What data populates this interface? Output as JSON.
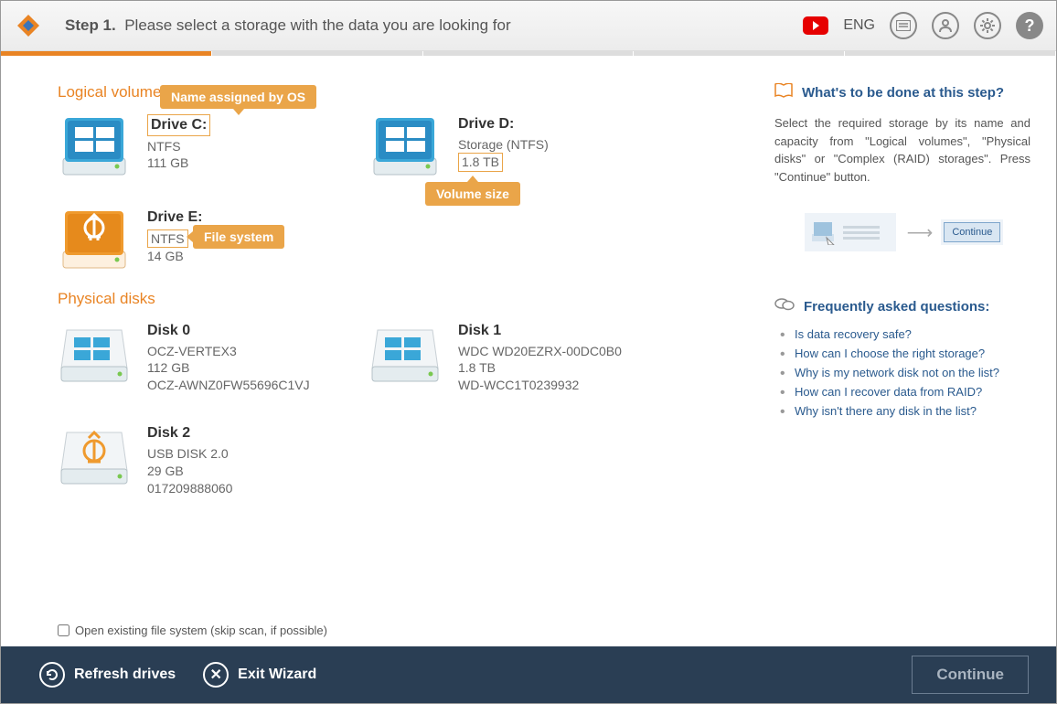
{
  "header": {
    "step_label": "Step 1.",
    "instruction": "Please select a storage with the data you are looking for",
    "lang": "ENG"
  },
  "sections": {
    "logical": "Logical volumes",
    "physical": "Physical disks"
  },
  "volumes": [
    {
      "name": "Drive C:",
      "fs": "NTFS",
      "size": "111 GB",
      "color": "blue"
    },
    {
      "name": "Drive D:",
      "fs": "Storage (NTFS)",
      "size": "1.8 TB",
      "color": "blue"
    },
    {
      "name": "Drive E:",
      "fs": "NTFS",
      "size": "14 GB",
      "color": "orange"
    }
  ],
  "disks": [
    {
      "name": "Disk 0",
      "model": "OCZ-VERTEX3",
      "size": "112 GB",
      "serial": "OCZ-AWNZ0FW55696C1VJ",
      "color": "blue"
    },
    {
      "name": "Disk 1",
      "model": "WDC WD20EZRX-00DC0B0",
      "size": "1.8 TB",
      "serial": "WD-WCC1T0239932",
      "color": "blue"
    },
    {
      "name": "Disk 2",
      "model": "USB DISK 2.0",
      "size": "29 GB",
      "serial": "017209888060",
      "color": "orange"
    }
  ],
  "callouts": {
    "name": "Name assigned by OS",
    "size": "Volume size",
    "fs": "File system"
  },
  "checkbox": "Open existing file system (skip scan, if possible)",
  "right": {
    "title": "What's to be done at this step?",
    "body": "Select the required storage by its name and capacity from \"Logical volumes\", \"Physical disks\" or \"Complex (RAID) storages\". Press \"Continue\" button.",
    "illus_btn": "Continue",
    "faq_title": "Frequently asked questions:",
    "faq": [
      "Is data recovery safe?",
      "How can I choose the right storage?",
      "Why is my network disk not on the list?",
      "How can I recover data from RAID?",
      "Why isn't there any disk in the list?"
    ]
  },
  "footer": {
    "refresh": "Refresh drives",
    "exit": "Exit Wizard",
    "continue": "Continue"
  }
}
